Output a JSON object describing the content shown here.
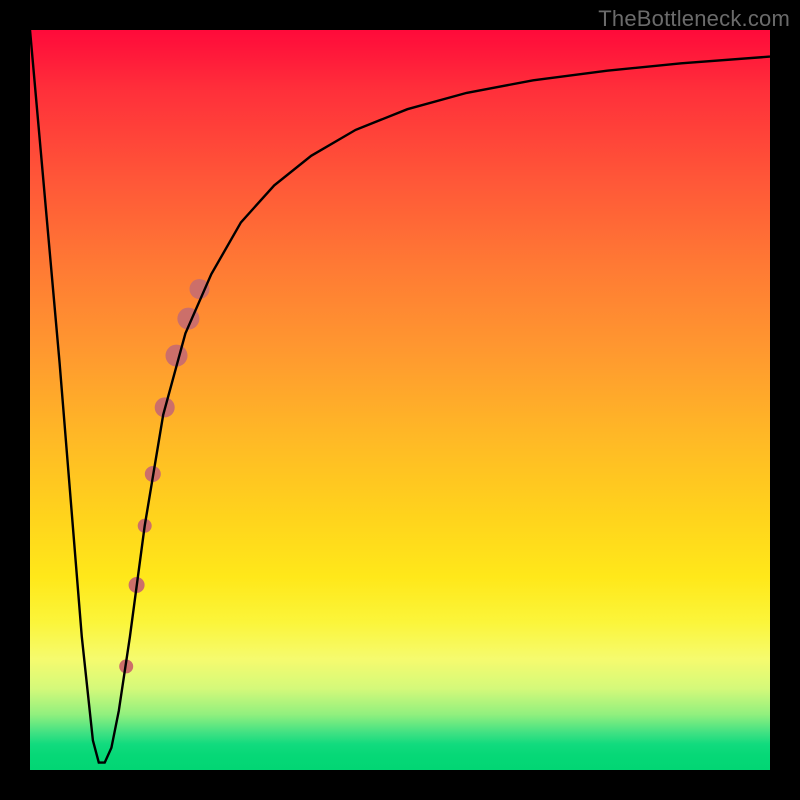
{
  "watermark": "TheBottleneck.com",
  "colors": {
    "curve": "#000000",
    "marker": "#cc6f6a",
    "marker_dark": "#c46863",
    "frame": "#000000"
  },
  "chart_data": {
    "type": "line",
    "title": "",
    "xlabel": "",
    "ylabel": "",
    "xlim": [
      0,
      100
    ],
    "ylim": [
      0,
      100
    ],
    "grid": false,
    "legend": null,
    "series": [
      {
        "name": "bottleneck-curve",
        "x": [
          0,
          4,
          7,
          8.5,
          9.3,
          10.1,
          11.0,
          12.0,
          13.5,
          15.5,
          18.0,
          21.0,
          24.5,
          28.5,
          33.0,
          38.0,
          44.0,
          51.0,
          59.0,
          68.0,
          78.0,
          88.0,
          100.0
        ],
        "y": [
          100,
          55,
          18,
          4,
          1,
          1,
          3,
          8,
          18,
          33,
          48,
          59,
          67,
          74,
          79,
          83,
          86.5,
          89.3,
          91.5,
          93.2,
          94.5,
          95.5,
          96.4
        ]
      }
    ],
    "markers": {
      "name": "highlight-range",
      "points": [
        {
          "x": 13.0,
          "y": 14,
          "r": 7
        },
        {
          "x": 14.4,
          "y": 25,
          "r": 8
        },
        {
          "x": 15.5,
          "y": 33,
          "r": 7
        },
        {
          "x": 16.6,
          "y": 40,
          "r": 8
        },
        {
          "x": 18.2,
          "y": 49,
          "r": 10
        },
        {
          "x": 19.8,
          "y": 56,
          "r": 11
        },
        {
          "x": 21.4,
          "y": 61,
          "r": 11
        },
        {
          "x": 22.9,
          "y": 65,
          "r": 10
        }
      ]
    }
  }
}
